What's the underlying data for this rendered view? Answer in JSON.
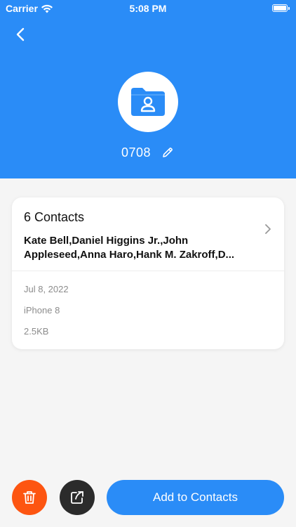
{
  "status_bar": {
    "carrier": "Carrier",
    "time": "5:08 PM"
  },
  "header": {
    "title": "0708",
    "background_color": "#2a8cf7",
    "back_icon": "chevron-left-icon",
    "folder_icon": "contact-folder-icon",
    "edit_icon": "pencil-icon"
  },
  "card": {
    "title": "6 Contacts",
    "names": "Kate Bell,Daniel Higgins Jr.,John Appleseed,Anna Haro,Hank M. Zakroff,D...",
    "date": "Jul 8, 2022",
    "device": "iPhone 8",
    "size": "2.5KB"
  },
  "actions": {
    "delete_icon": "trash-icon",
    "delete_color": "#fd5511",
    "share_icon": "share-icon",
    "share_color": "#2b2b2b",
    "add_label": "Add to Contacts",
    "add_color": "#2a8cf7"
  }
}
